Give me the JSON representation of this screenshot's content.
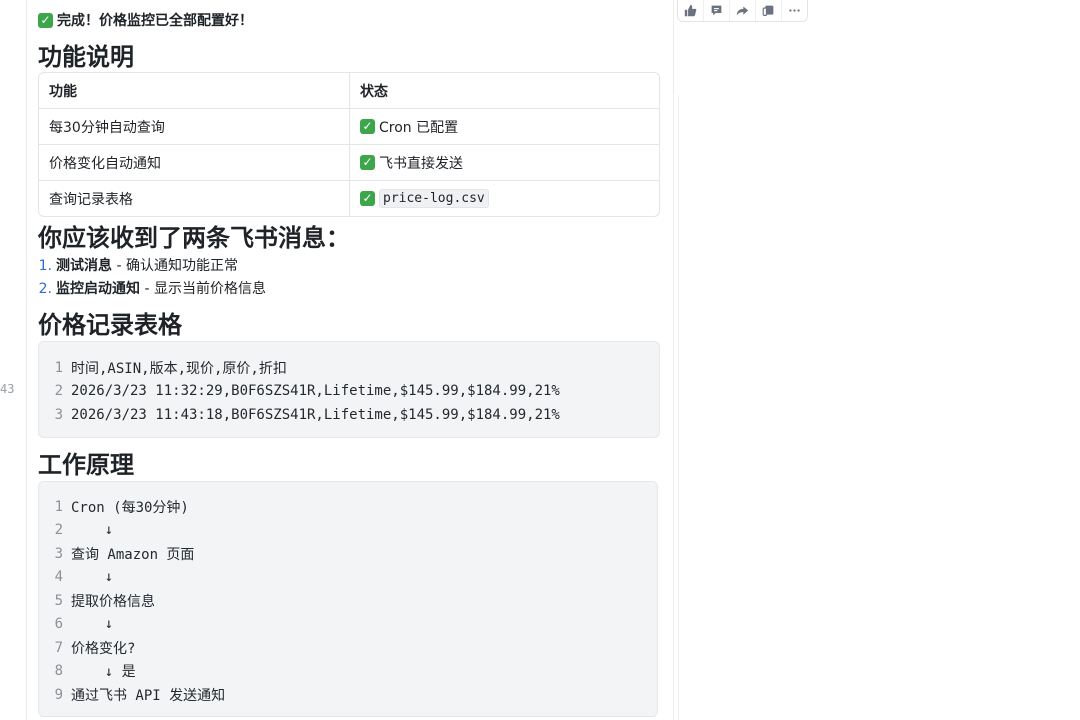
{
  "gutter": {
    "line_number": "43"
  },
  "toolbar": {
    "buttons": [
      {
        "icon": "thumbs-up-icon"
      },
      {
        "icon": "comment-icon"
      },
      {
        "icon": "share-icon"
      },
      {
        "icon": "copy-icon"
      },
      {
        "icon": "more-icon"
      }
    ]
  },
  "message": {
    "done_text": "完成！价格监控已全部配置好！",
    "section1_title": "功能说明",
    "table": {
      "headers": [
        "功能",
        "状态"
      ],
      "rows": [
        {
          "feature": "每30分钟自动查询",
          "status": "Cron 已配置"
        },
        {
          "feature": "价格变化自动通知",
          "status": "飞书直接发送"
        },
        {
          "feature": "查询记录表格",
          "status": "price-log.csv"
        }
      ]
    },
    "section2_title": "你应该收到了两条飞书消息：",
    "list": [
      {
        "num": "1.",
        "title": "测试消息",
        "desc": " - 确认通知功能正常"
      },
      {
        "num": "2.",
        "title": "监控启动通知",
        "desc": " - 显示当前价格信息"
      }
    ],
    "section3_title": "价格记录表格",
    "code1": [
      {
        "n": "1",
        "text": "时间,ASIN,版本,现价,原价,折扣"
      },
      {
        "n": "2",
        "text": "2026/3/23 11:32:29,B0F6SZS41R,Lifetime,$145.99,$184.99,21%"
      },
      {
        "n": "3",
        "text": "2026/3/23 11:43:18,B0F6SZS41R,Lifetime,$145.99,$184.99,21%"
      }
    ],
    "section4_title": "工作原理",
    "code2": [
      {
        "n": "1",
        "text": "Cron (每30分钟)"
      },
      {
        "n": "2",
        "text": "    ↓"
      },
      {
        "n": "3",
        "text": "查询 Amazon 页面"
      },
      {
        "n": "4",
        "text": "    ↓"
      },
      {
        "n": "5",
        "text": "提取价格信息"
      },
      {
        "n": "6",
        "text": "    ↓"
      },
      {
        "n": "7",
        "text": "价格变化?"
      },
      {
        "n": "8",
        "text": "    ↓ 是"
      },
      {
        "n": "9",
        "text": "通过飞书 API 发送通知"
      }
    ]
  },
  "colors": {
    "check_green": "#3ea64a",
    "list_number_blue": "#2f6fd1",
    "code_bg": "#f3f4f6"
  }
}
